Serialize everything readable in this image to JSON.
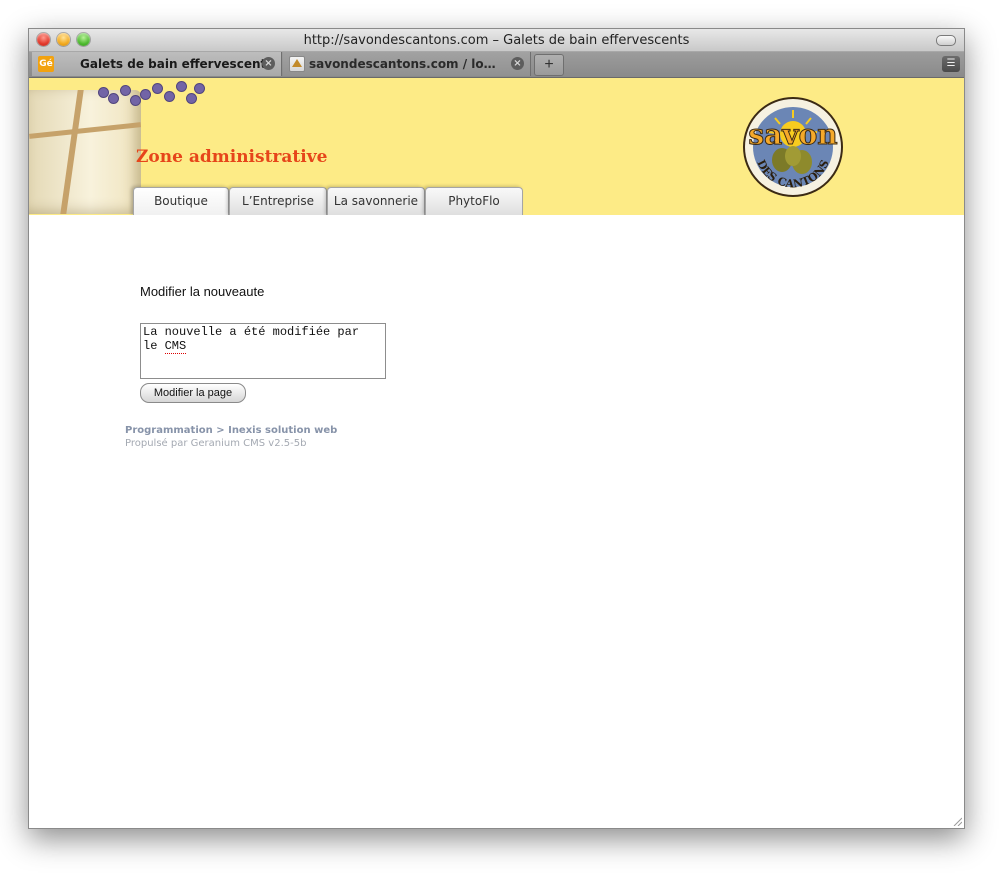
{
  "browser": {
    "window_title": "http://savondescantons.com – Galets de bain effervescents",
    "tabs": [
      {
        "favicon": "Gé",
        "label": "Galets de bain effervescents"
      },
      {
        "favicon": "PMA",
        "label": "savondescantons.com / localho..."
      }
    ],
    "new_tab_label": "+"
  },
  "header": {
    "zone_title": "Zone administrative",
    "logo": {
      "top": "savon",
      "bottom": "DES CANTONS"
    },
    "nav": [
      "Boutique",
      "L’Entreprise",
      "La savonnerie",
      "PhytoFlo"
    ]
  },
  "main": {
    "heading": "Modifier la nouveaute",
    "editor_text_1": "La nouvelle a été modifiée par",
    "editor_text_2_pre": "le ",
    "editor_text_2_word": "CMS",
    "submit_label": "Modifier la page"
  },
  "footer": {
    "credit": "Programmation > Inexis solution web",
    "powered": "Propulsé par Geranium CMS v2.5-5b"
  },
  "colors": {
    "header_bg": "#fdeb86",
    "zone_title": "#e6451a",
    "footer_link": "#8793a9"
  }
}
